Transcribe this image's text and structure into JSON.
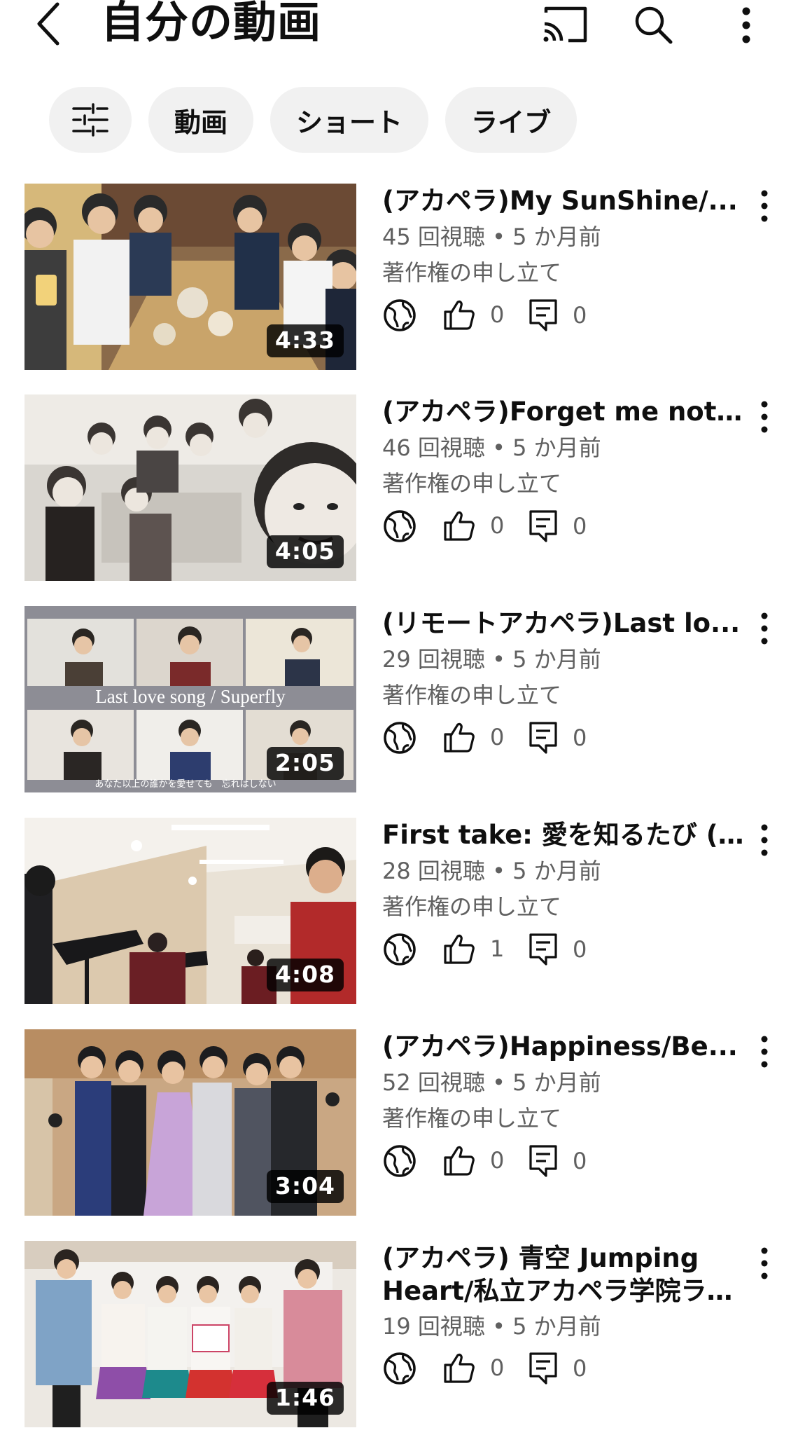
{
  "header": {
    "title": "自分の動画",
    "back_icon": "chevron-left-icon",
    "cast_icon": "cast-icon",
    "search_icon": "search-icon",
    "more_icon": "more-vert-icon"
  },
  "chips": [
    {
      "label": "",
      "icon": "tune-sliders-icon"
    },
    {
      "label": "動画"
    },
    {
      "label": "ショート"
    },
    {
      "label": "ライブ"
    }
  ],
  "videos": [
    {
      "title": "(アカペラ)My SunShine/...",
      "views": "45 回視聴",
      "age": "5 か月前",
      "claim": "著作権の申し立て",
      "likes": "0",
      "comments": "0",
      "duration": "4:33",
      "thumb_overlay": ""
    },
    {
      "title": "(アカペラ)Forget me not/...",
      "views": "46 回視聴",
      "age": "5 か月前",
      "claim": "著作権の申し立て",
      "likes": "0",
      "comments": "0",
      "duration": "4:05",
      "thumb_overlay": ""
    },
    {
      "title": "(リモートアカペラ)Last lo...",
      "views": "29 回視聴",
      "age": "5 か月前",
      "claim": "著作権の申し立て",
      "likes": "0",
      "comments": "0",
      "duration": "2:05",
      "thumb_overlay": "Last love song / Superfly",
      "thumb_caption": "あなた以上の誰かを愛せても　忘れはしない"
    },
    {
      "title": "First take: 愛を知るたび (…",
      "views": "28 回視聴",
      "age": "5 か月前",
      "claim": "著作権の申し立て",
      "likes": "1",
      "comments": "0",
      "duration": "4:08",
      "thumb_overlay": ""
    },
    {
      "title": "(アカペラ)Happiness/Be...",
      "views": "52 回視聴",
      "age": "5 か月前",
      "claim": "著作権の申し立て",
      "likes": "0",
      "comments": "0",
      "duration": "3:04",
      "thumb_overlay": ""
    },
    {
      "title": "(アカペラ) 青空 Jumping Heart/私立アカペラ学院ラ…",
      "views": "19 回視聴",
      "age": "5 か月前",
      "claim": "",
      "likes": "0",
      "comments": "0",
      "duration": "1:46",
      "thumb_overlay": ""
    }
  ],
  "meta_separator": "•",
  "icons": {
    "visibility": "globe-public-icon",
    "like": "thumb-up-icon",
    "comment": "comment-icon",
    "item_menu": "more-vert-icon"
  },
  "colors": {
    "text_primary": "#0f0f0f",
    "text_secondary": "#606060",
    "chip_bg": "#f1f1f1",
    "duration_bg": "#000000"
  }
}
